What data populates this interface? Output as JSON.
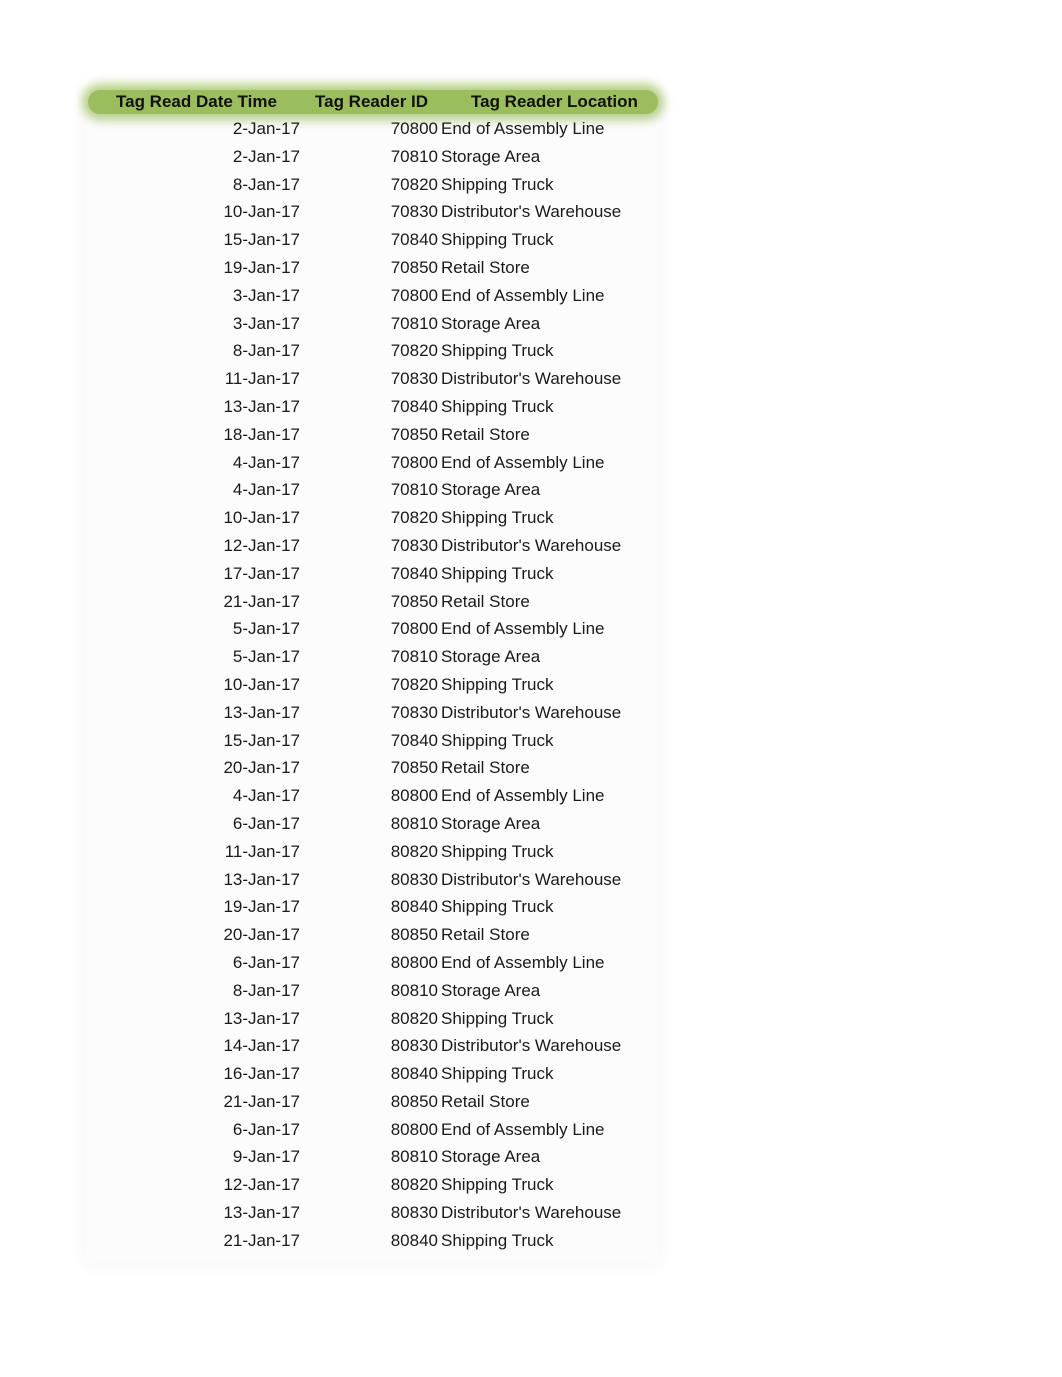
{
  "table": {
    "columns": [
      "Tag Read Date Time",
      "Tag Reader ID",
      "Tag Reader Location"
    ],
    "header_color": "#9cbd5e",
    "rows": [
      {
        "date": "2-Jan-17",
        "id": "70800",
        "location": "End of Assembly Line"
      },
      {
        "date": "2-Jan-17",
        "id": "70810",
        "location": "Storage Area"
      },
      {
        "date": "8-Jan-17",
        "id": "70820",
        "location": "Shipping Truck"
      },
      {
        "date": "10-Jan-17",
        "id": "70830",
        "location": "Distributor's Warehouse"
      },
      {
        "date": "15-Jan-17",
        "id": "70840",
        "location": "Shipping Truck"
      },
      {
        "date": "19-Jan-17",
        "id": "70850",
        "location": "Retail Store"
      },
      {
        "date": "3-Jan-17",
        "id": "70800",
        "location": "End of Assembly Line"
      },
      {
        "date": "3-Jan-17",
        "id": "70810",
        "location": "Storage Area"
      },
      {
        "date": "8-Jan-17",
        "id": "70820",
        "location": "Shipping Truck"
      },
      {
        "date": "11-Jan-17",
        "id": "70830",
        "location": "Distributor's Warehouse"
      },
      {
        "date": "13-Jan-17",
        "id": "70840",
        "location": "Shipping Truck"
      },
      {
        "date": "18-Jan-17",
        "id": "70850",
        "location": "Retail Store"
      },
      {
        "date": "4-Jan-17",
        "id": "70800",
        "location": "End of Assembly Line"
      },
      {
        "date": "4-Jan-17",
        "id": "70810",
        "location": "Storage Area"
      },
      {
        "date": "10-Jan-17",
        "id": "70820",
        "location": "Shipping Truck"
      },
      {
        "date": "12-Jan-17",
        "id": "70830",
        "location": "Distributor's Warehouse"
      },
      {
        "date": "17-Jan-17",
        "id": "70840",
        "location": "Shipping Truck"
      },
      {
        "date": "21-Jan-17",
        "id": "70850",
        "location": "Retail Store"
      },
      {
        "date": "5-Jan-17",
        "id": "70800",
        "location": "End of Assembly Line"
      },
      {
        "date": "5-Jan-17",
        "id": "70810",
        "location": "Storage Area"
      },
      {
        "date": "10-Jan-17",
        "id": "70820",
        "location": "Shipping Truck"
      },
      {
        "date": "13-Jan-17",
        "id": "70830",
        "location": "Distributor's Warehouse"
      },
      {
        "date": "15-Jan-17",
        "id": "70840",
        "location": "Shipping Truck"
      },
      {
        "date": "20-Jan-17",
        "id": "70850",
        "location": "Retail Store"
      },
      {
        "date": "4-Jan-17",
        "id": "80800",
        "location": "End of Assembly Line"
      },
      {
        "date": "6-Jan-17",
        "id": "80810",
        "location": "Storage Area"
      },
      {
        "date": "11-Jan-17",
        "id": "80820",
        "location": "Shipping Truck"
      },
      {
        "date": "13-Jan-17",
        "id": "80830",
        "location": "Distributor's Warehouse"
      },
      {
        "date": "19-Jan-17",
        "id": "80840",
        "location": "Shipping Truck"
      },
      {
        "date": "20-Jan-17",
        "id": "80850",
        "location": "Retail Store"
      },
      {
        "date": "6-Jan-17",
        "id": "80800",
        "location": "End of Assembly Line"
      },
      {
        "date": "8-Jan-17",
        "id": "80810",
        "location": "Storage Area"
      },
      {
        "date": "13-Jan-17",
        "id": "80820",
        "location": "Shipping Truck"
      },
      {
        "date": "14-Jan-17",
        "id": "80830",
        "location": "Distributor's Warehouse"
      },
      {
        "date": "16-Jan-17",
        "id": "80840",
        "location": "Shipping Truck"
      },
      {
        "date": "21-Jan-17",
        "id": "80850",
        "location": "Retail Store"
      },
      {
        "date": "6-Jan-17",
        "id": "80800",
        "location": "End of Assembly Line"
      },
      {
        "date": "9-Jan-17",
        "id": "80810",
        "location": "Storage Area"
      },
      {
        "date": "12-Jan-17",
        "id": "80820",
        "location": "Shipping Truck"
      },
      {
        "date": "13-Jan-17",
        "id": "80830",
        "location": "Distributor's Warehouse"
      },
      {
        "date": "21-Jan-17",
        "id": "80840",
        "location": "Shipping Truck"
      }
    ]
  }
}
